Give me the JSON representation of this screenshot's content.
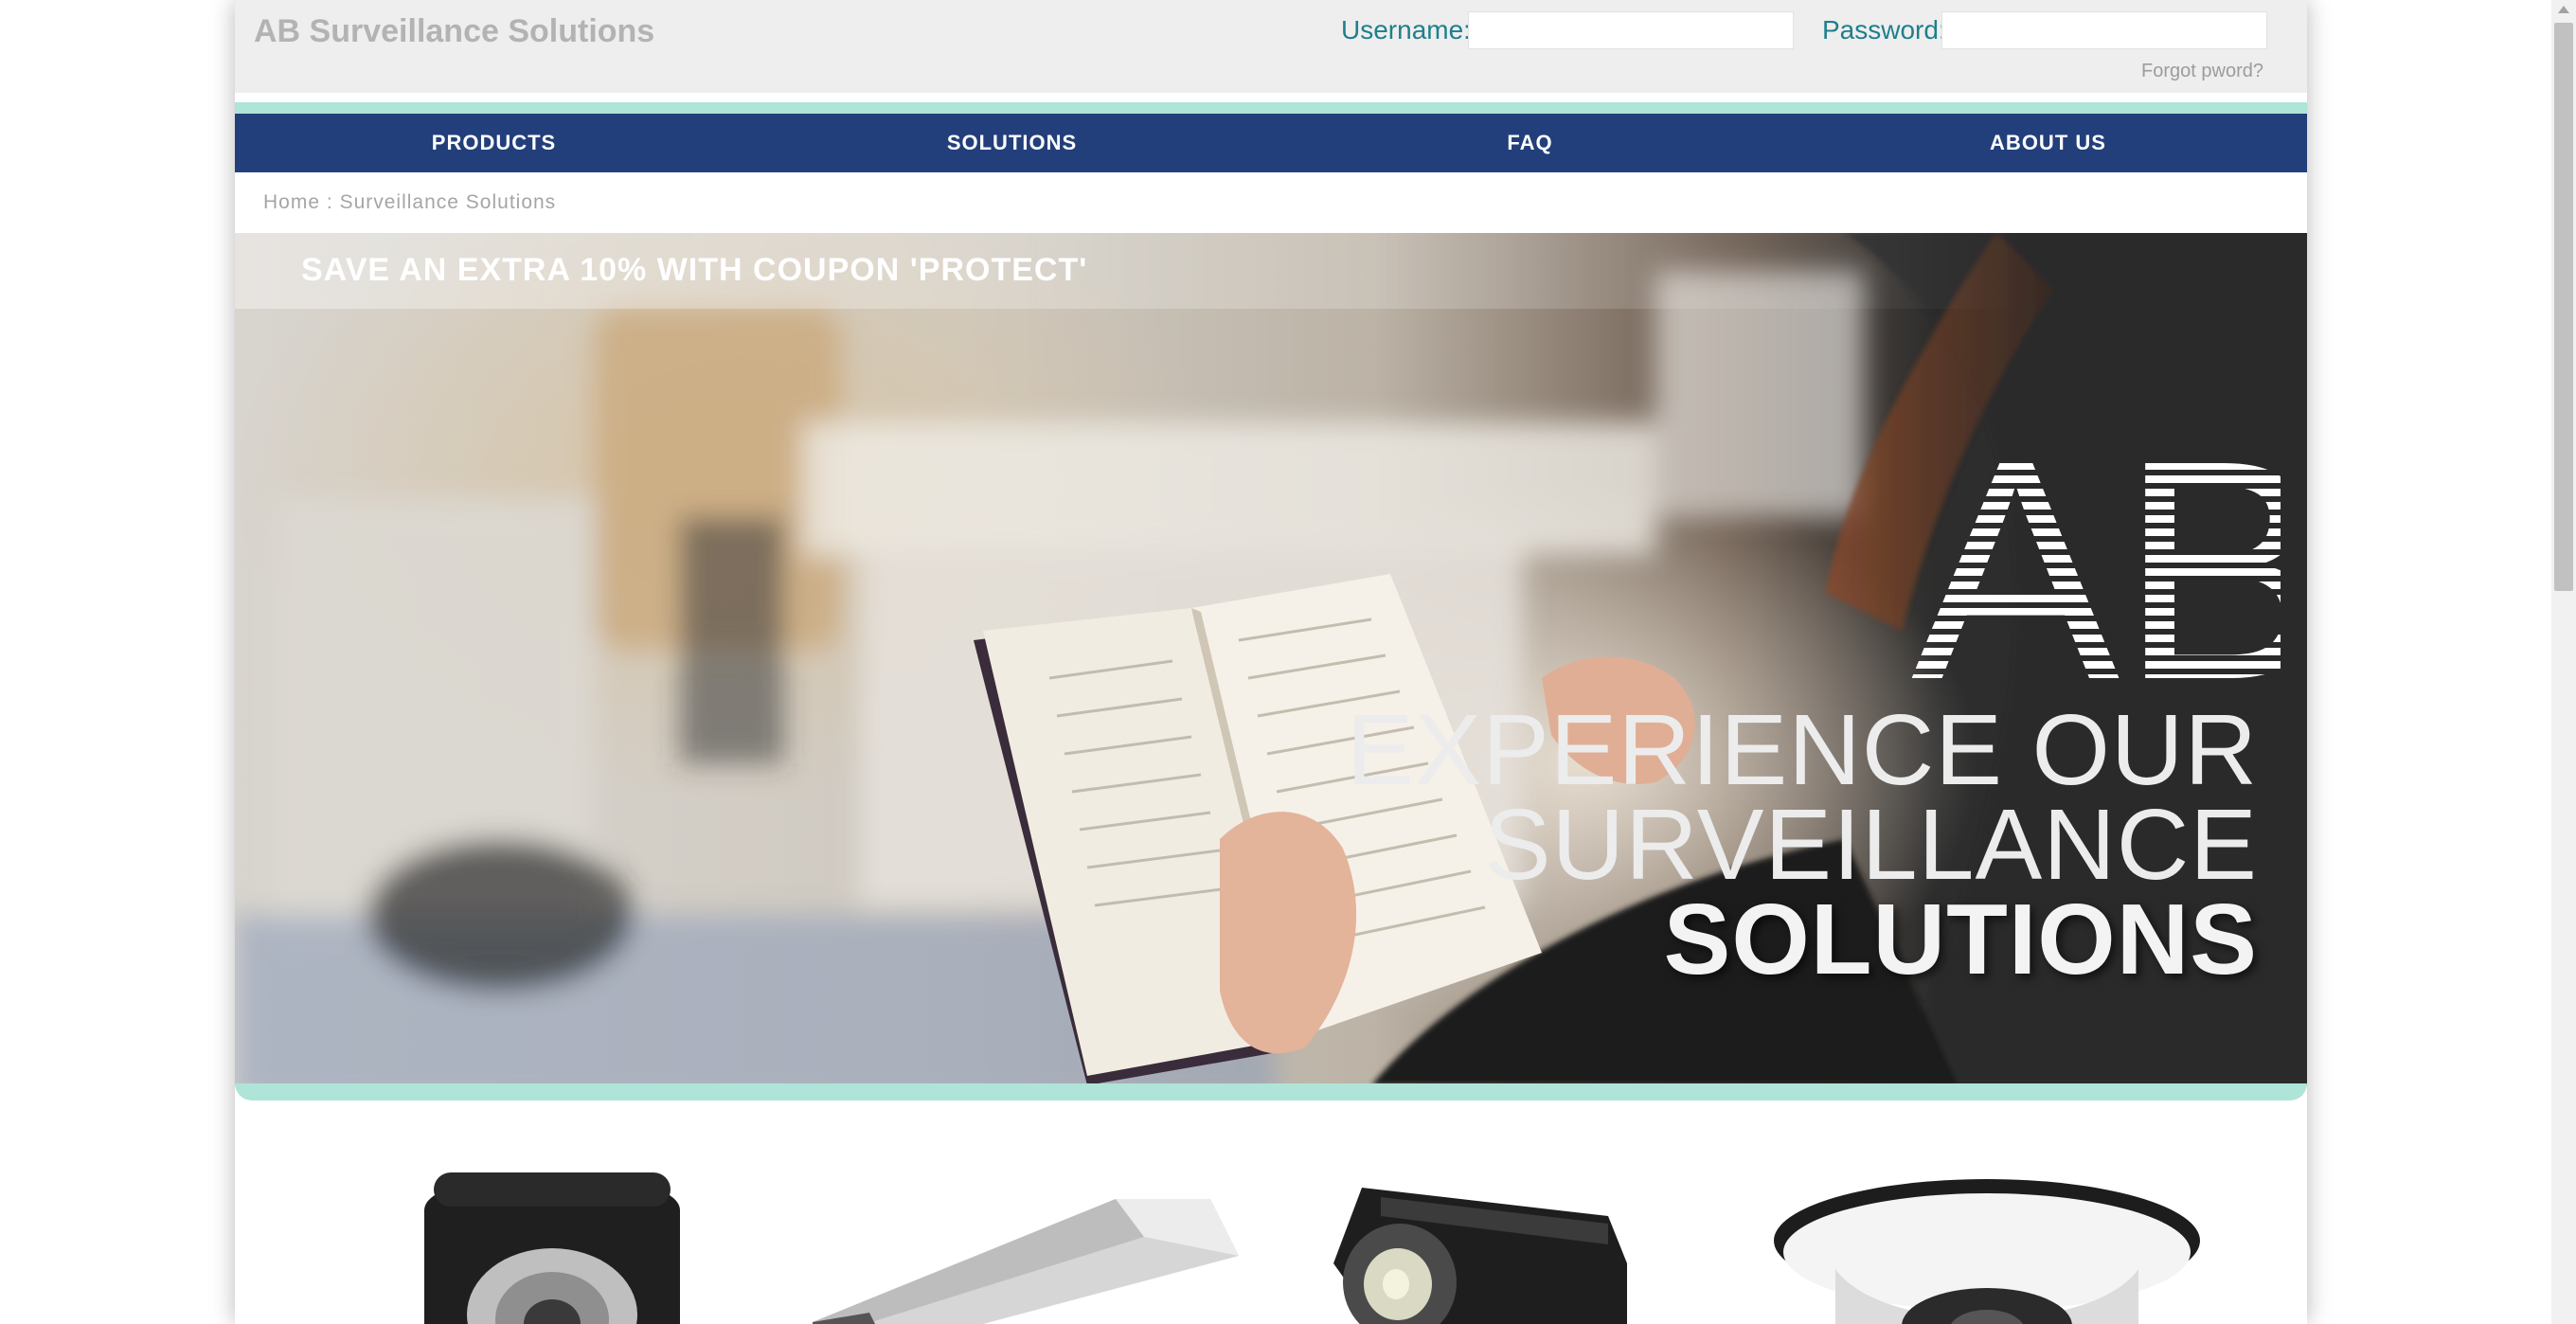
{
  "header": {
    "site_title": "AB Surveillance Solutions",
    "username_label": "Username:",
    "password_label": "Password:",
    "username_value": "",
    "password_value": "",
    "forgot_link": "Forgot pword?"
  },
  "nav": {
    "items": [
      {
        "label": "PRODUCTS"
      },
      {
        "label": "SOLUTIONS"
      },
      {
        "label": "FAQ"
      },
      {
        "label": "ABOUT US"
      }
    ]
  },
  "breadcrumb": {
    "home": "Home",
    "separator": ":",
    "current": "Surveillance Solutions"
  },
  "hero": {
    "coupon": "SAVE AN EXTRA 10% WITH COUPON 'PROTECT'",
    "logo_text": "AB",
    "line1": "EXPERIENCE OUR",
    "line2": "SURVEILLANCE",
    "line3": "SOLUTIONS"
  },
  "products": [
    {
      "name": "dome-camera-black-icon"
    },
    {
      "name": "bullet-camera-silver-icon"
    },
    {
      "name": "box-camera-black-icon"
    },
    {
      "name": "dome-camera-white-icon"
    }
  ],
  "colors": {
    "nav_bg": "#223f7b",
    "accent": "#aee5d8",
    "label_teal": "#1e7f8c",
    "header_bg": "#eeeeee"
  }
}
